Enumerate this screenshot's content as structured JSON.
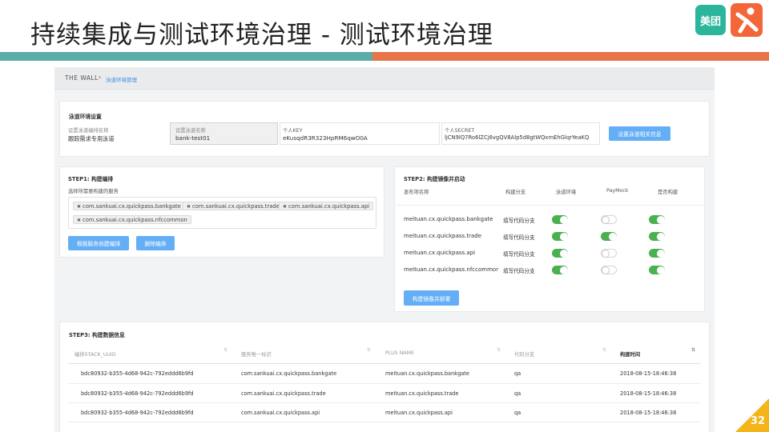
{
  "slide": {
    "title": "持续集成与测试环境治理 - 测试环境治理",
    "logo_meituan": "美团",
    "page_number": "32"
  },
  "breadcrumb": {
    "root": "THE WALL",
    "separator": "›",
    "current": "泳道环境管理"
  },
  "settings": {
    "title": "泳道环境设置",
    "fields": [
      {
        "label": "设置泳道编排名称",
        "value": "跟踪需求专用泳道"
      },
      {
        "label": "设置泳道名称",
        "value": "bank-test01"
      },
      {
        "label": "个人KEY",
        "value": "eKusqdR3R323HpRM6qwO0A"
      },
      {
        "label": "个人SECRET",
        "value": "ljCN9lQ7Ro6lZCj6vgQV8Alp5d8gtWQxmEhGlqrYeaKQ"
      }
    ],
    "button": "设置泳道相关信息"
  },
  "step1": {
    "title": "STEP1: 构建编排",
    "label": "选择所需要构建的服务",
    "tags": [
      "com.sankuai.cx.quickpass.bankgate",
      "com.sankuai.cx.quickpass.trade",
      "com.sankuai.cx.quickpass.api",
      "com.sankuai.cx.quickpass.nfccommon"
    ],
    "tag_remove": "✖",
    "btn_create": "根据服务创建编排",
    "btn_delete": "删除编排"
  },
  "step2": {
    "title": "STEP2: 构建镜像并启动",
    "headers": [
      "发布项名称",
      "构建分支",
      "泳道环境",
      "PayMock",
      "是否构建"
    ],
    "rows": [
      {
        "name": "meituan.cx.quickpass.bankgate",
        "branch": "填写代码分支",
        "lane": true,
        "paymock": false,
        "build": true
      },
      {
        "name": "meituan.cx.quickpass.trade",
        "branch": "填写代码分支",
        "lane": true,
        "paymock": true,
        "build": true
      },
      {
        "name": "meituan.cx.quickpass.api",
        "branch": "填写代码分支",
        "lane": true,
        "paymock": false,
        "build": true
      },
      {
        "name": "meituan.cx.quickpass.nfccommor",
        "branch": "填写代码分支",
        "lane": true,
        "paymock": false,
        "build": true
      }
    ],
    "button": "构建镜像并部署"
  },
  "step3": {
    "title": "STEP3: 构建数据信息",
    "headers": [
      "编排STACK_UUID",
      "服务唯一标识",
      "PLUS NAME",
      "代码分支",
      "构建时间"
    ],
    "sort_icon": "⇅",
    "rows": [
      [
        "bdc80932-b355-4d68-942c-792eddd6b9fd",
        "com.sankuai.cx.quickpass.bankgate",
        "meituan.cx.quickpass.bankgate",
        "qa",
        "2018-08-15-18:46:38"
      ],
      [
        "bdc80932-b355-4d68-942c-792eddd6b9fd",
        "com.sankuai.cx.quickpass.trade",
        "meituan.cx.quickpass.trade",
        "qa",
        "2018-08-15-18:46:38"
      ],
      [
        "bdc80932-b355-4d68-942c-792eddd6b9fd",
        "com.sankuai.cx.quickpass.api",
        "meituan.cx.quickpass.api",
        "qa",
        "2018-08-15-18:46:38"
      ]
    ]
  },
  "colors": {
    "accent": "#64aef6",
    "teal": "#5aaea7",
    "orange": "#e8744a",
    "toggle_on": "#4caf50",
    "page_corner": "#f5b417"
  }
}
